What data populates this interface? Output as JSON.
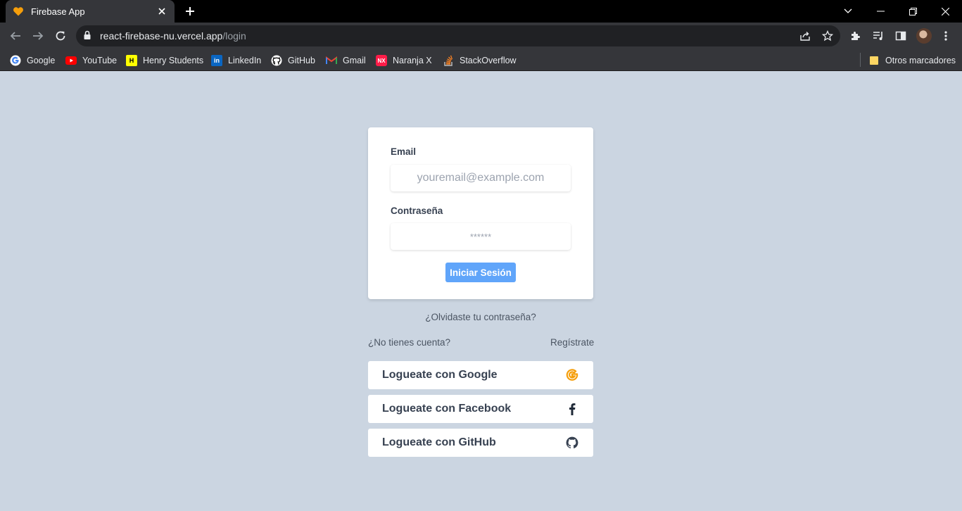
{
  "browser": {
    "tab_title": "Firebase App",
    "url_host": "react-firebase-nu.vercel.app",
    "url_path": "/login"
  },
  "bookmarks": [
    {
      "label": "Google",
      "icon": "google-icon"
    },
    {
      "label": "YouTube",
      "icon": "youtube-icon"
    },
    {
      "label": "Henry Students",
      "icon": "henry-icon"
    },
    {
      "label": "LinkedIn",
      "icon": "linkedin-icon"
    },
    {
      "label": "GitHub",
      "icon": "github-icon"
    },
    {
      "label": "Gmail",
      "icon": "gmail-icon"
    },
    {
      "label": "Naranja X",
      "icon": "naranja-x-icon"
    },
    {
      "label": "StackOverflow",
      "icon": "stackoverflow-icon"
    }
  ],
  "other_bookmarks": "Otros marcadores",
  "login": {
    "email_label": "Email",
    "email_placeholder": "youremail@example.com",
    "password_label": "Contraseña",
    "password_placeholder": "******",
    "submit_label": "Iniciar Sesión"
  },
  "forgot_password": "¿Olvidaste tu contraseña?",
  "no_account": "¿No tienes cuenta?",
  "register": "Regístrate",
  "social": [
    {
      "label": "Logueate con Google",
      "icon": "google-icon",
      "color": "#f59e0b"
    },
    {
      "label": "Logueate con Facebook",
      "icon": "facebook-icon",
      "color": "#1f2937"
    },
    {
      "label": "Logueate con GitHub",
      "icon": "github-icon",
      "color": "#374151"
    }
  ],
  "colors": {
    "page_bg": "#cbd5e1",
    "primary_button": "#60a5fa"
  }
}
